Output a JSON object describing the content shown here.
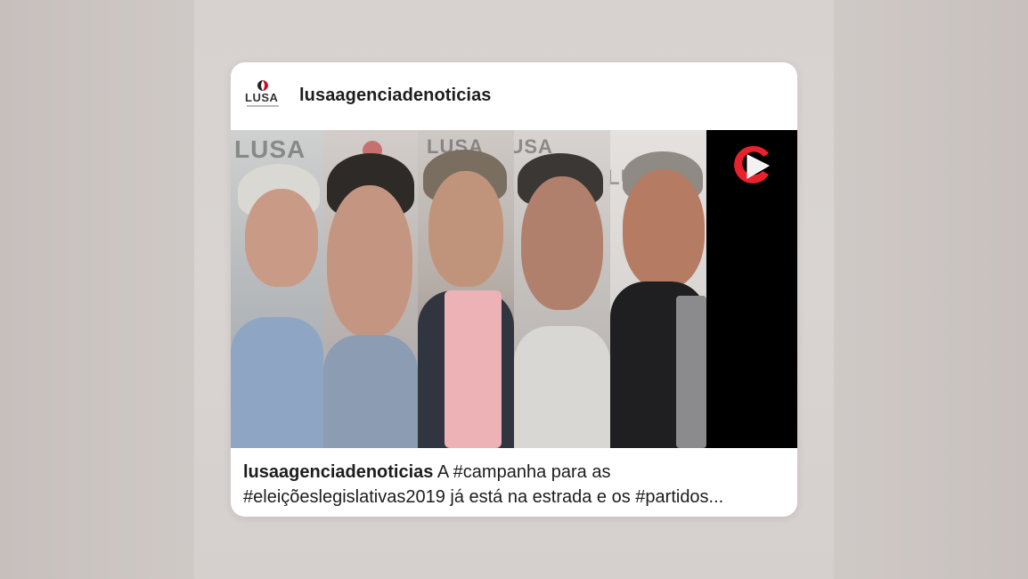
{
  "post": {
    "username": "lusaagenciadenoticias",
    "logo": {
      "text": "LUSA",
      "mark_color": "#c8102e"
    },
    "media": {
      "type": "video",
      "play_icon": "play-icon",
      "wall_text": [
        "LUSA",
        "LUSA",
        "LUSA",
        "LUSA"
      ],
      "accent_color": "#e8212c"
    },
    "caption": {
      "username": "lusaagenciadenoticias",
      "line1": " A #campanha para as",
      "line2": "#eleiçõeslegislativas2019 já está na estrada e os #partidos..."
    }
  }
}
